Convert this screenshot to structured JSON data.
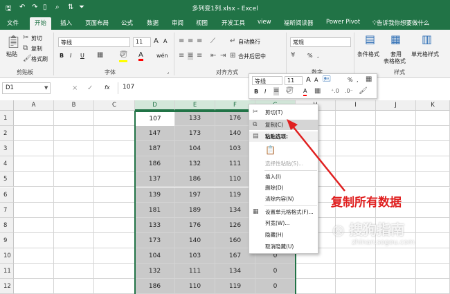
{
  "window": {
    "title": "多列变1列.xlsx - Excel"
  },
  "tabs": [
    "文件",
    "开始",
    "插入",
    "页面布局",
    "公式",
    "数据",
    "审阅",
    "视图",
    "开发工具",
    "view",
    "福昕阅读器",
    "Power Pivot"
  ],
  "active_tab": "开始",
  "tell_me": "告诉我你想要做什么",
  "ribbon": {
    "clipboard": {
      "paste": "粘贴",
      "cut": "剪切",
      "copy": "复制",
      "format_painter": "格式刷",
      "label": "剪贴板"
    },
    "font": {
      "name": "等线",
      "size": "11",
      "bold": "B",
      "italic": "I",
      "underline": "U",
      "grow": "A",
      "shrink": "A",
      "color": "A",
      "phonetic": "wén",
      "label": "字体"
    },
    "alignment": {
      "wrap": "自动换行",
      "merge": "合并后居中",
      "label": "对齐方式"
    },
    "number": {
      "format": "常规",
      "percent": "%",
      "comma": ",",
      "label": "数字"
    },
    "styles": {
      "conditional": "条件格式",
      "table_line1": "套用",
      "table_line2": "表格格式",
      "cell_styles": "单元格样式",
      "label": "样式"
    }
  },
  "formula_bar": {
    "name_box": "D1",
    "value": "107",
    "cancel": "×",
    "enter": "✓",
    "fx": "fx"
  },
  "columns": [
    "A",
    "B",
    "C",
    "D",
    "E",
    "F",
    "G",
    "H",
    "I",
    "J",
    "K"
  ],
  "rows": [
    "1",
    "2",
    "3",
    "4",
    "5",
    "6",
    "7",
    "8",
    "9",
    "10",
    "11",
    "12"
  ],
  "grid": {
    "D": [
      "107",
      "147",
      "187",
      "186",
      "137",
      "139",
      "181",
      "133",
      "173",
      "104",
      "132",
      "186"
    ],
    "E": [
      "133",
      "173",
      "104",
      "132",
      "186",
      "197",
      "189",
      "176",
      "140",
      "103",
      "111",
      "110"
    ],
    "F": [
      "176",
      "140",
      "103",
      "111",
      "110",
      "119",
      "134",
      "126",
      "160",
      "167",
      "134",
      "119"
    ],
    "G": [
      "",
      "",
      "",
      "",
      "",
      "",
      "",
      "",
      "",
      "0",
      "0",
      "0"
    ]
  },
  "mini_toolbar": {
    "font": "等线",
    "size": "11",
    "percent": "%",
    "comma": ",",
    "bold": "B",
    "italic": "I",
    "grow": "A",
    "shrink": "A",
    "color": "A"
  },
  "context_menu": {
    "items": [
      {
        "label": "剪切(T)",
        "state": "normal",
        "icon": "✂"
      },
      {
        "label": "复制(C)",
        "state": "highlighted",
        "icon": "⧉"
      },
      {
        "label": "粘贴选项:",
        "state": "header",
        "icon": "▤"
      },
      {
        "label": "",
        "state": "paste-icon",
        "icon": "📋"
      },
      {
        "label": "选择性粘贴(S)...",
        "state": "disabled",
        "icon": ""
      },
      {
        "label": "插入(I)",
        "state": "normal",
        "icon": ""
      },
      {
        "label": "删除(D)",
        "state": "normal",
        "icon": ""
      },
      {
        "label": "清除内容(N)",
        "state": "normal",
        "icon": ""
      },
      {
        "label": "设置单元格格式(F)...",
        "state": "normal",
        "icon": "▦"
      },
      {
        "label": "列宽(W)...",
        "state": "normal",
        "icon": ""
      },
      {
        "label": "隐藏(H)",
        "state": "normal",
        "icon": ""
      },
      {
        "label": "取消隐藏(U)",
        "state": "normal",
        "icon": ""
      }
    ]
  },
  "annotation": {
    "text": "复制所有数据",
    "color": "#e02020"
  },
  "watermark": {
    "text": "搜狗指南",
    "url": "zhinan.sogou.com"
  },
  "colors": {
    "excel_green": "#217346",
    "selection": "#c9c9c9",
    "header_selected": "#d3e7da"
  }
}
